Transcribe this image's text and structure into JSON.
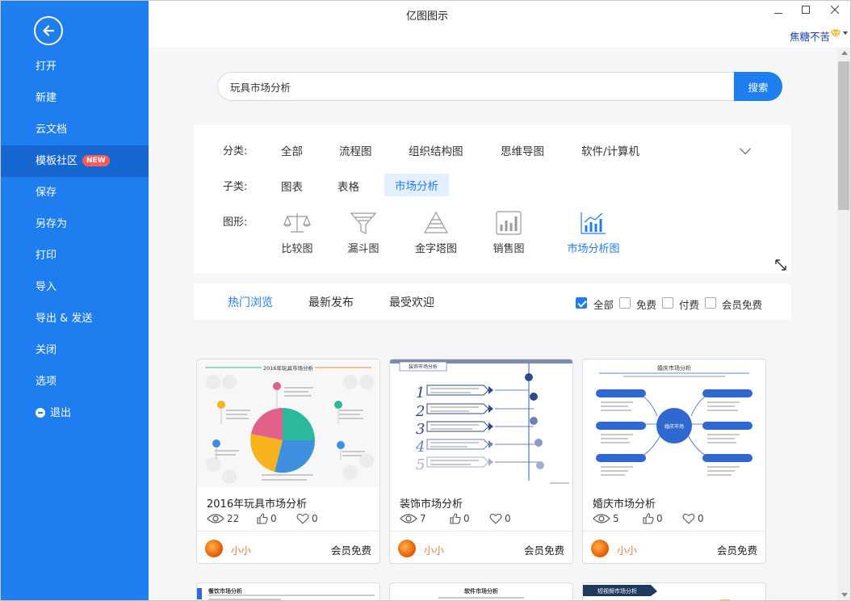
{
  "window": {
    "title": "亿图图示",
    "user": "焦糖不苦"
  },
  "sidebar": {
    "items": [
      {
        "label": "打开"
      },
      {
        "label": "新建"
      },
      {
        "label": "云文档"
      },
      {
        "label": "模板社区",
        "badge": "NEW"
      },
      {
        "label": "保存"
      },
      {
        "label": "另存为"
      },
      {
        "label": "打印"
      },
      {
        "label": "导入"
      },
      {
        "label": "导出 & 发送"
      },
      {
        "label": "关闭"
      },
      {
        "label": "选项"
      },
      {
        "label": "退出"
      }
    ]
  },
  "search": {
    "value": "玩具市场分析",
    "button": "搜索"
  },
  "filters": {
    "category_label": "分类:",
    "categories": [
      "全部",
      "流程图",
      "组织结构图",
      "思维导图",
      "软件/计算机"
    ],
    "sub_label": "子类:",
    "subcategories": [
      "图表",
      "表格",
      "市场分析"
    ],
    "shape_label": "图形:",
    "shapes": [
      "比较图",
      "漏斗图",
      "金字塔图",
      "销售图",
      "市场分析图"
    ]
  },
  "sort": {
    "tabs": [
      "热门浏览",
      "最新发布",
      "最受欢迎"
    ],
    "checks": [
      {
        "label": "全部",
        "checked": true
      },
      {
        "label": "免费",
        "checked": false
      },
      {
        "label": "付费",
        "checked": false
      },
      {
        "label": "会员免费",
        "checked": false
      }
    ]
  },
  "cards": [
    {
      "title": "2016年玩具市场分析",
      "views": "22",
      "likes": "0",
      "favs": "0",
      "author": "小小",
      "price": "会员免费",
      "thumb_heading": "2016年玩具市场分析"
    },
    {
      "title": "装饰市场分析",
      "views": "7",
      "likes": "0",
      "favs": "0",
      "author": "小小",
      "price": "会员免费",
      "thumb_heading": "装饰市场分析"
    },
    {
      "title": "婚庆市场分析",
      "views": "5",
      "likes": "0",
      "favs": "0",
      "author": "小小",
      "price": "会员免费",
      "thumb_heading": "婚庆市场分析",
      "thumb_center": "婚庆市场"
    }
  ],
  "next_cards": [
    {
      "thumb_heading": "餐饮市场分析"
    },
    {
      "thumb_heading": "软件市场分析"
    },
    {
      "thumb_heading": "短视频市场分析"
    }
  ],
  "colors": {
    "primary": "#1e7ef0",
    "sidebar_active": "#1667d1",
    "author": "#f07a3b",
    "badge": "#ff5a5a"
  }
}
